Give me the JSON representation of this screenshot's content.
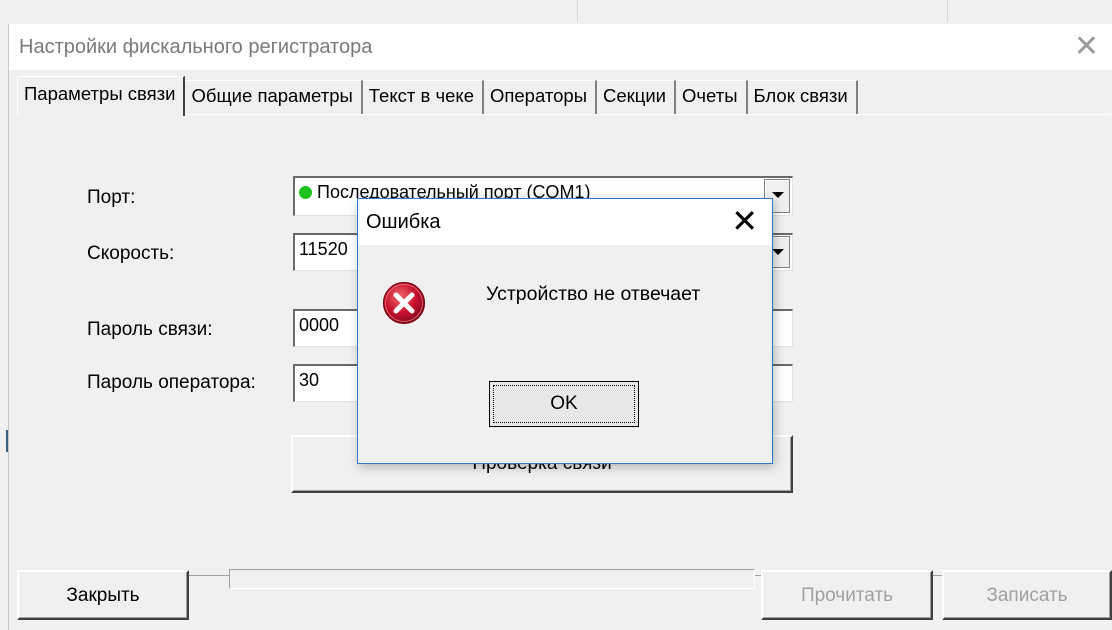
{
  "window": {
    "title": "Настройки фискального регистратора",
    "close_glyph": "✕"
  },
  "tabs": [
    {
      "label": "Параметры связи",
      "active": true
    },
    {
      "label": "Общие параметры",
      "active": false
    },
    {
      "label": "Текст в чеке",
      "active": false
    },
    {
      "label": "Операторы",
      "active": false
    },
    {
      "label": "Секции",
      "active": false
    },
    {
      "label": "Очеты",
      "active": false
    },
    {
      "label": "Блок связи",
      "active": false
    }
  ],
  "form": {
    "port_label": "Порт:",
    "port_value": "Последовательный порт (COM1)",
    "port_status_color": "#1ec21e",
    "speed_label": "Скорость:",
    "speed_value": "11520",
    "conn_password_label": "Пароль связи:",
    "conn_password_value": "0000",
    "operator_password_label": "Пароль оператора:",
    "operator_password_value": "30",
    "check_button": "Проверка связи"
  },
  "footer": {
    "close_button": "Закрыть",
    "read_button": "Прочитать",
    "write_button": "Записать"
  },
  "dialog": {
    "title": "Ошибка",
    "close_glyph": "✕",
    "message": "Устройство не отвечает",
    "ok_button": "OK",
    "icon": "error-icon",
    "icon_color": "#c8102e"
  }
}
